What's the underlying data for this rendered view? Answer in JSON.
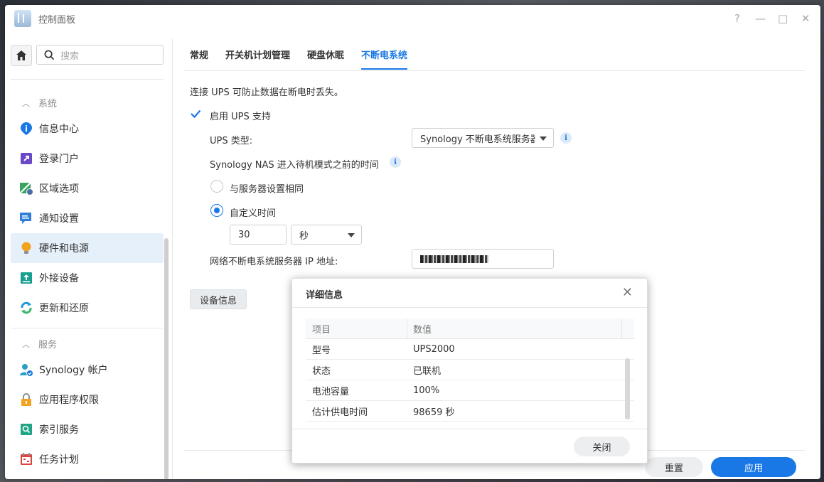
{
  "window": {
    "title": "控制面板",
    "controls": [
      "?",
      "—",
      "□",
      "✕"
    ]
  },
  "search": {
    "placeholder": "搜索"
  },
  "sidebar": {
    "groups": [
      {
        "label": "系统",
        "items": [
          {
            "label": "信息中心",
            "icon": "info-icon",
            "color": "#1978e5"
          },
          {
            "label": "登录门户",
            "icon": "login-portal-icon",
            "color": "#6b48c8"
          },
          {
            "label": "区域选项",
            "icon": "region-map-icon",
            "color": "#3aa35f"
          },
          {
            "label": "通知设置",
            "icon": "chat-bubble-icon",
            "color": "#2f7fd8"
          },
          {
            "label": "硬件和电源",
            "icon": "lightbulb-icon",
            "color": "#f2a321",
            "active": true
          },
          {
            "label": "外接设备",
            "icon": "upload-device-icon",
            "color": "#1aa091"
          },
          {
            "label": "更新和还原",
            "icon": "refresh-icon",
            "color": "#1d9bd8"
          }
        ]
      },
      {
        "label": "服务",
        "items": [
          {
            "label": "Synology 帐户",
            "icon": "user-check-icon",
            "color": "#2aa0c8"
          },
          {
            "label": "应用程序权限",
            "icon": "lock-icon",
            "color": "#f2a321"
          },
          {
            "label": "索引服务",
            "icon": "index-search-icon",
            "color": "#20a585"
          },
          {
            "label": "任务计划",
            "icon": "calendar-icon",
            "color": "#d9453c"
          }
        ]
      }
    ]
  },
  "tabs": [
    {
      "label": "常规"
    },
    {
      "label": "开关机计划管理"
    },
    {
      "label": "硬盘休眠"
    },
    {
      "label": "不断电系统",
      "active": true
    }
  ],
  "ups": {
    "description": "连接 UPS 可防止数据在断电时丢失。",
    "enable_label": "启用 UPS 支持",
    "enabled": true,
    "type_label": "UPS 类型:",
    "type_value": "Synology 不断电系统服务器",
    "standby_label": "Synology NAS 进入待机模式之前的时间",
    "option_same": "与服务器设置相同",
    "option_custom": "自定义时间",
    "selected_option": "custom",
    "custom_time_value": "30",
    "time_unit": "秒",
    "server_ip_label": "网络不断电系统服务器 IP 地址:",
    "server_ip_value": "",
    "device_info_button": "设备信息"
  },
  "footer": {
    "reset_button": "重置",
    "apply_button": "应用"
  },
  "dialog": {
    "title": "详细信息",
    "columns": [
      "项目",
      "数值"
    ],
    "rows": [
      {
        "item": "型号",
        "value": "UPS2000"
      },
      {
        "item": "状态",
        "value": "已联机"
      },
      {
        "item": "电池容量",
        "value": "100%"
      },
      {
        "item": "估计供电时间",
        "value": "98659 秒"
      }
    ],
    "close_button": "关闭"
  },
  "colors": {
    "accent": "#1978e5",
    "active_bg": "#e6f0fb"
  }
}
